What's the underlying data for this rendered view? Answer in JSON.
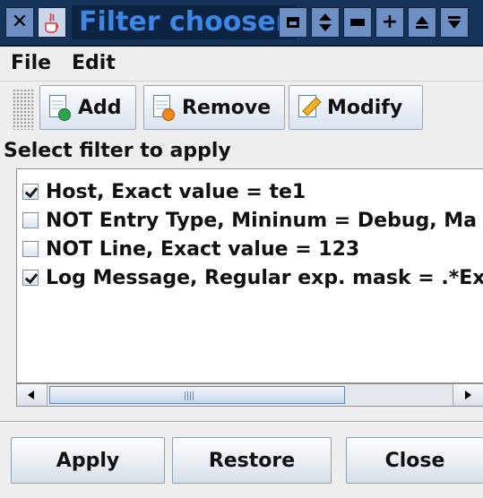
{
  "window": {
    "title": "Filter chooser",
    "controls": [
      "close-icon",
      "java-icon",
      "minimize-icon",
      "sort-icon",
      "maximize-icon",
      "plus-icon",
      "arrow-up-icon",
      "arrow-down-icon"
    ]
  },
  "menu": {
    "file": "File",
    "edit": "Edit"
  },
  "toolbar": {
    "add": "Add",
    "remove": "Remove",
    "modify": "Modify"
  },
  "section_label": "Select filter to apply",
  "filters": [
    {
      "text": "Host, Exact value = te1",
      "checked": true
    },
    {
      "text": "NOT Entry Type, Mininum = Debug, Ma",
      "checked": false
    },
    {
      "text": "NOT Line, Exact value = 123",
      "checked": false
    },
    {
      "text": "Log Message, Regular exp. mask = .*Ex",
      "checked": true
    }
  ],
  "buttons": {
    "apply": "Apply",
    "restore": "Restore",
    "close": "Close"
  },
  "colors": {
    "titlebar": "#16345a",
    "title_text": "#3d86e6",
    "background": "#eeeeee"
  }
}
